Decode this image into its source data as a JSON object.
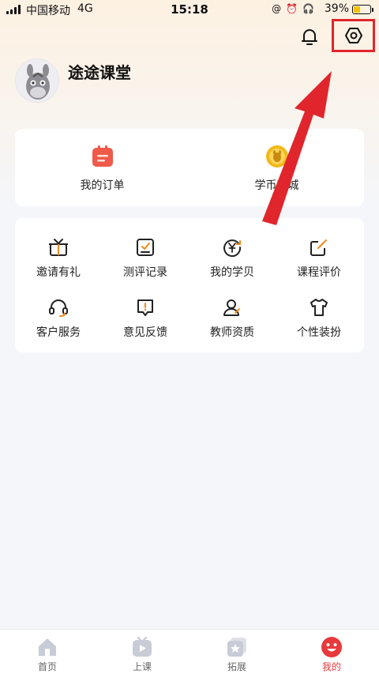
{
  "status_bar": {
    "carrier": "中国移动",
    "network": "4G",
    "time": "15:18",
    "battery_percent": "39%",
    "battery_level": 0.39
  },
  "header": {
    "notification_icon": "bell-icon",
    "settings_icon": "settings-hexagon-icon"
  },
  "profile": {
    "name": "途途课堂"
  },
  "quick_actions": [
    {
      "label": "我的订单",
      "icon": "order-icon"
    },
    {
      "label": "学币商城",
      "icon": "coin-icon"
    }
  ],
  "features": [
    {
      "label": "邀请有礼",
      "icon": "gift-icon"
    },
    {
      "label": "测评记录",
      "icon": "evaluation-icon"
    },
    {
      "label": "我的学贝",
      "icon": "yuan-icon"
    },
    {
      "label": "课程评价",
      "icon": "edit-icon"
    },
    {
      "label": "客户服务",
      "icon": "headset-icon"
    },
    {
      "label": "意见反馈",
      "icon": "feedback-icon"
    },
    {
      "label": "教师资质",
      "icon": "teacher-icon"
    },
    {
      "label": "个性装扮",
      "icon": "tshirt-icon"
    }
  ],
  "tabs": [
    {
      "label": "首页",
      "icon": "home-icon"
    },
    {
      "label": "上课",
      "icon": "play-icon"
    },
    {
      "label": "拓展",
      "icon": "star-icon"
    },
    {
      "label": "我的",
      "icon": "smiley-icon"
    }
  ],
  "colors": {
    "accent": "#e8393d",
    "highlight_box": "#e0262c",
    "order_icon": "#ef5a4a",
    "coin_icon": "#f2b818"
  }
}
